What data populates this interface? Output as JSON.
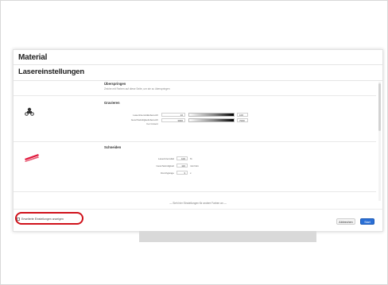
{
  "dialog": {
    "title": "Material",
    "subtitle": "Lasereinstellungen"
  },
  "sections": {
    "skip": {
      "title": "Überspringen",
      "hint": "Zeiche mit Farben auf diese Seite, um sie zu überspringen"
    },
    "engrave": {
      "title": "Gravieren",
      "icon": "engrave-icon",
      "rows": [
        {
          "label": "Laserintensitätsbereich",
          "start": "10",
          "end": "100"
        },
        {
          "label": "Geschwindigkeitsbereich",
          "sub": "bei Gravur",
          "start": "3000",
          "end": "7000"
        }
      ]
    },
    "cut": {
      "title": "Schneiden",
      "icon": "cut-material-icon",
      "rows": [
        {
          "label": "Laserintensität",
          "value": "100",
          "unit": "%"
        },
        {
          "label": "Geschwindigkeit",
          "value": "110",
          "unit": "mm/min"
        },
        {
          "label": "Durchgänge",
          "value": "3",
          "unit": "x"
        }
      ]
    }
  },
  "footer": {
    "hint": "— Sieh hier Einstellungen für andere Farben an —",
    "advanced_label": "Erweiterte Einstellungen anzeigen",
    "cancel_label": "Abbrechen",
    "start_label": "Start"
  },
  "colors": {
    "accent": "#2a6fd6",
    "highlight": "#d0121b",
    "cut_icon": "#e0183c"
  }
}
